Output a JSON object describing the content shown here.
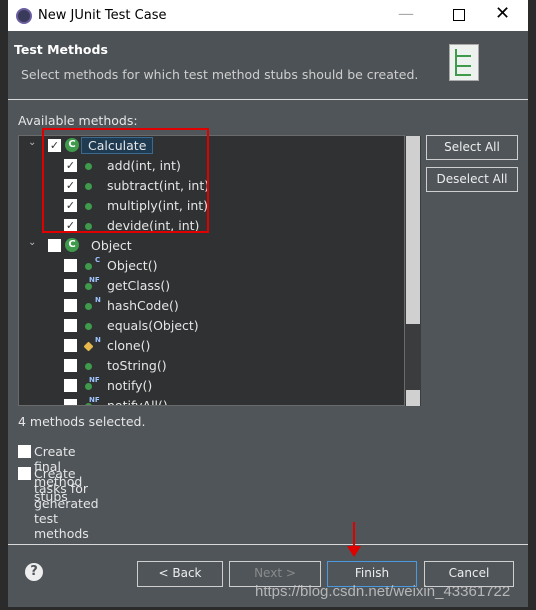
{
  "window": {
    "title": "New JUnit Test Case"
  },
  "header": {
    "title": "Test Methods",
    "description": "Select methods for which test method stubs should be created."
  },
  "available_label": "Available methods:",
  "tree": [
    {
      "label": "Calculate",
      "level": 0,
      "checked": true,
      "icon": "class-icon",
      "selected": true
    },
    {
      "label": "add(int, int)",
      "level": 1,
      "checked": true,
      "icon": "public-method-icon"
    },
    {
      "label": "subtract(int, int)",
      "level": 1,
      "checked": true,
      "icon": "public-method-icon"
    },
    {
      "label": "multiply(int, int)",
      "level": 1,
      "checked": true,
      "icon": "public-method-icon"
    },
    {
      "label": "devide(int, int)",
      "level": 1,
      "checked": true,
      "icon": "public-method-icon"
    },
    {
      "label": "Object",
      "level": 0,
      "checked": false,
      "icon": "class-icon"
    },
    {
      "label": "Object()",
      "level": 1,
      "checked": false,
      "icon": "constructor-icon",
      "overlay": "C"
    },
    {
      "label": "getClass()",
      "level": 1,
      "checked": false,
      "icon": "public-method-icon",
      "overlay": "NF"
    },
    {
      "label": "hashCode()",
      "level": 1,
      "checked": false,
      "icon": "public-method-icon",
      "overlay": "N"
    },
    {
      "label": "equals(Object)",
      "level": 1,
      "checked": false,
      "icon": "public-method-icon"
    },
    {
      "label": "clone()",
      "level": 1,
      "checked": false,
      "icon": "protected-method-icon",
      "overlay": "N"
    },
    {
      "label": "toString()",
      "level": 1,
      "checked": false,
      "icon": "public-method-icon"
    },
    {
      "label": "notify()",
      "level": 1,
      "checked": false,
      "icon": "public-method-icon",
      "overlay": "NF"
    },
    {
      "label": "notifyAll()",
      "level": 1,
      "checked": false,
      "icon": "public-method-icon",
      "overlay": "NF"
    }
  ],
  "buttons": {
    "select_all": "Select All",
    "deselect_all": "Deselect All",
    "back": "< Back",
    "next": "Next >",
    "finish": "Finish",
    "cancel": "Cancel"
  },
  "status": "4 methods selected.",
  "options": [
    {
      "label": "Create final method stubs",
      "checked": false
    },
    {
      "label": "Create tasks for generated test methods",
      "checked": false
    }
  ],
  "watermark": "https://blog.csdn.net/weixin_43361722",
  "colors": {
    "annotation": "#e00000",
    "accent": "#3f9a4c"
  }
}
